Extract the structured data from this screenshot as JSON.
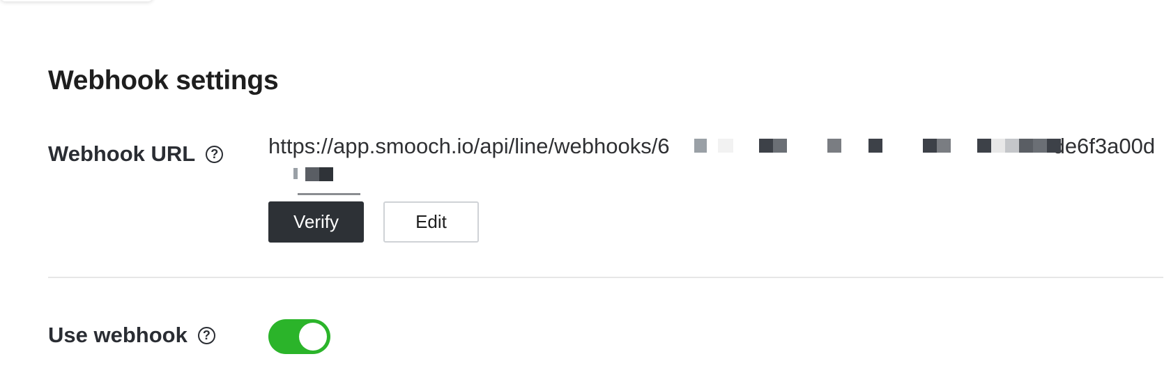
{
  "section": {
    "title": "Webhook settings"
  },
  "webhook_url_row": {
    "label": "Webhook URL",
    "help_icon": "question-circle-icon",
    "value_line1": "https://app.smooch.io/api/line/webhooks/6",
    "value_line1_end": "de6f3a0",
    "value_line2": "0d",
    "verify_label": "Verify",
    "edit_label": "Edit"
  },
  "use_webhook_row": {
    "label": "Use webhook",
    "help_icon": "question-circle-icon",
    "enabled": true
  },
  "colors": {
    "toggle_on": "#2bb42a",
    "verify_button_bg": "#2d3136",
    "text": "#1e1e1e"
  }
}
